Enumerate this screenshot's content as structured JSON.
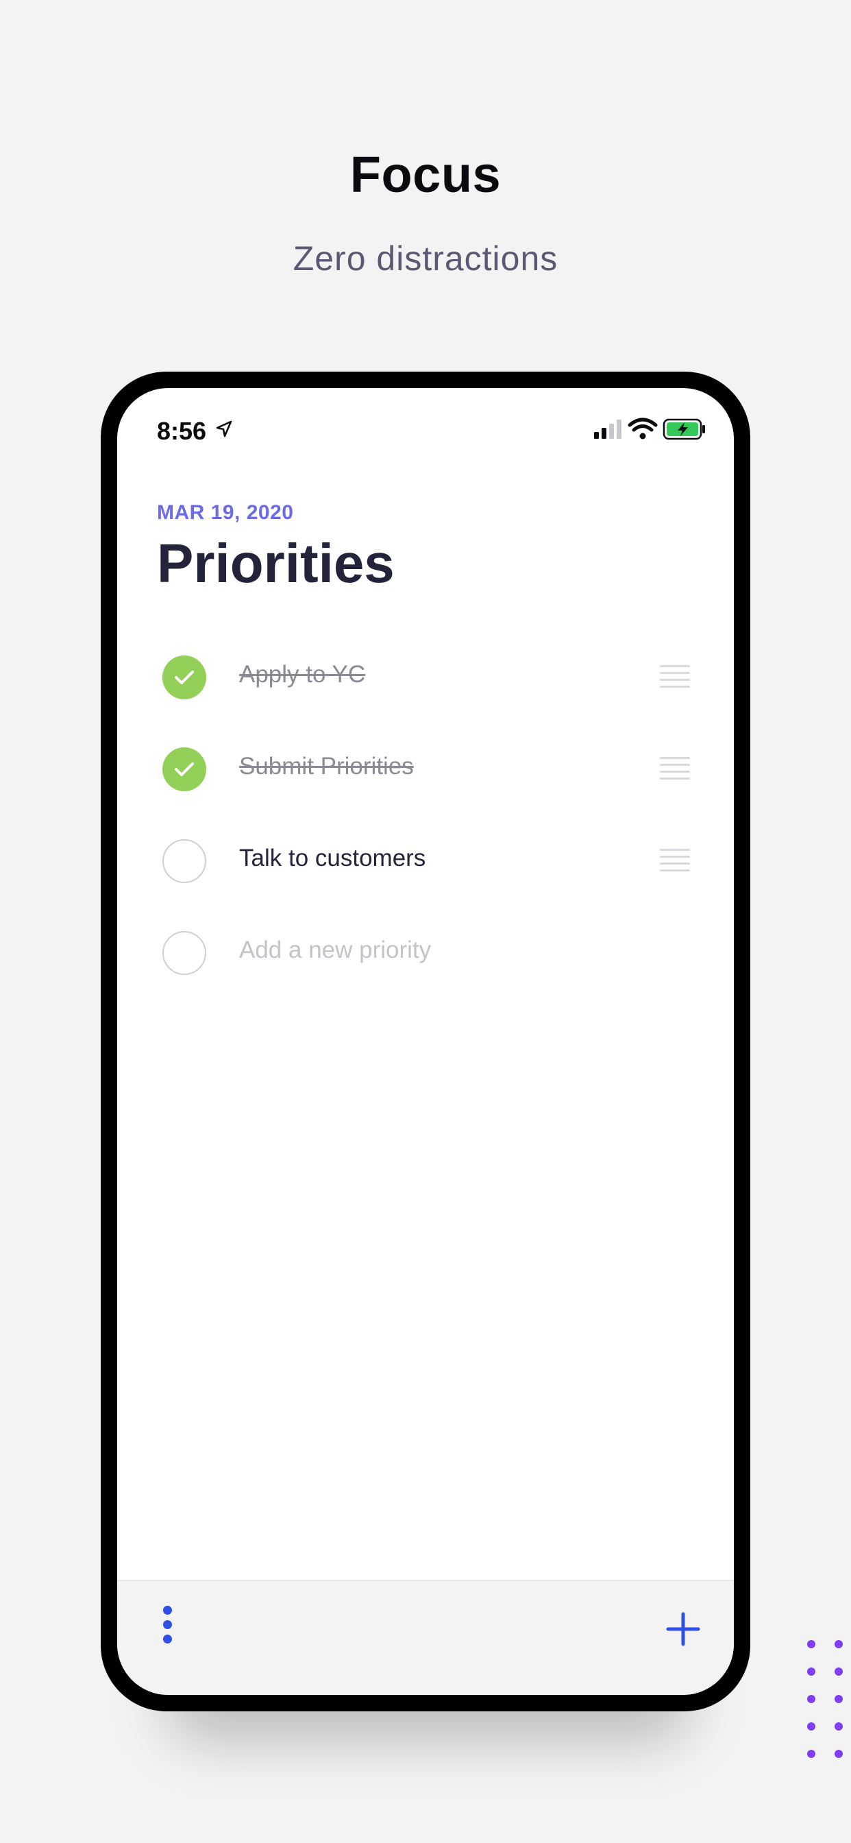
{
  "marketing": {
    "title": "Focus",
    "subtitle": "Zero distractions"
  },
  "status_bar": {
    "time": "8:56",
    "icons": [
      "location-arrow-icon",
      "signal-icon",
      "wifi-icon",
      "battery-charging-icon"
    ],
    "battery_color": "#34c759"
  },
  "header": {
    "date": "MAR 19, 2020",
    "title": "Priorities"
  },
  "priorities": [
    {
      "label": "Apply to YC",
      "done": true
    },
    {
      "label": "Submit Priorities",
      "done": true
    },
    {
      "label": "Talk to customers",
      "done": false
    }
  ],
  "new_priority": {
    "placeholder": "Add a new priority"
  },
  "bottom_bar": {
    "menu_icon": "more-vertical-icon",
    "add_icon": "plus-icon"
  },
  "colors": {
    "accent": "#2f4ee6",
    "date_color": "#6b6bea",
    "check_done": "#93d057",
    "decoration": "#7d3ff0"
  }
}
